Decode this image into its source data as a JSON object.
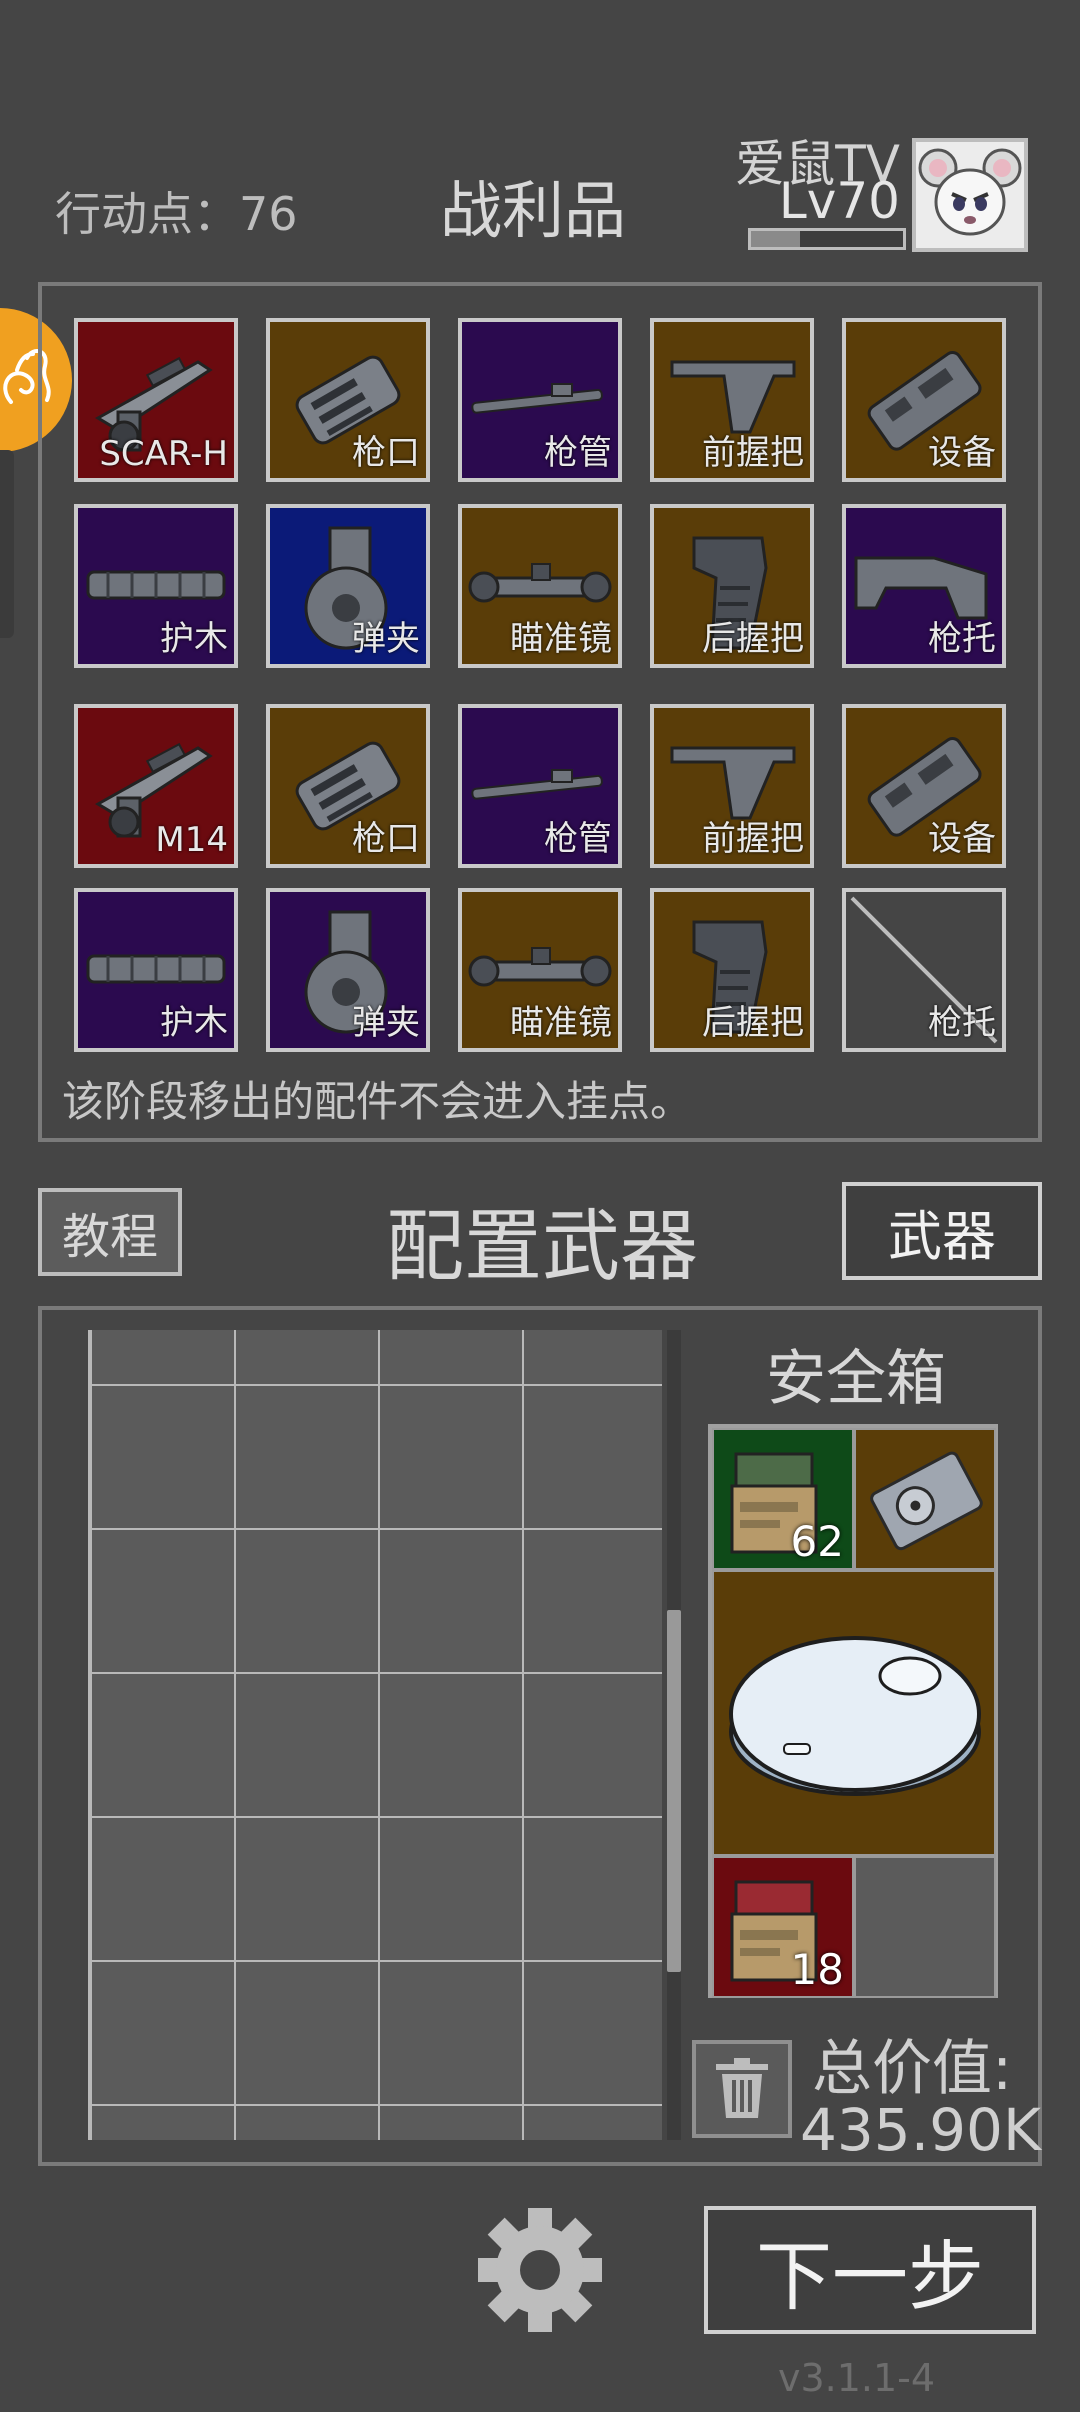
{
  "header": {
    "action_points_label": "行动点：",
    "action_points_value": "76",
    "title": "战利品",
    "username": "爱鼠TV",
    "level": "Lv70",
    "xp_fraction": 0.32
  },
  "loot": {
    "rows": [
      [
        {
          "label": "SCAR-H",
          "rarity": "red",
          "icon": "rifle-icon"
        },
        {
          "label": "枪口",
          "rarity": "orange",
          "icon": "muzzle-icon"
        },
        {
          "label": "枪管",
          "rarity": "purple",
          "icon": "barrel-icon"
        },
        {
          "label": "前握把",
          "rarity": "orange",
          "icon": "foregrip-icon"
        },
        {
          "label": "设备",
          "rarity": "orange",
          "icon": "device-icon"
        }
      ],
      [
        {
          "label": "护木",
          "rarity": "purple",
          "icon": "handguard-icon"
        },
        {
          "label": "弹夹",
          "rarity": "blue",
          "icon": "magazine-icon"
        },
        {
          "label": "瞄准镜",
          "rarity": "orange",
          "icon": "scope-icon"
        },
        {
          "label": "后握把",
          "rarity": "orange",
          "icon": "grip-icon"
        },
        {
          "label": "枪托",
          "rarity": "purple",
          "icon": "stock-icon"
        }
      ],
      [
        {
          "label": "M14",
          "rarity": "red",
          "icon": "rifle-icon"
        },
        {
          "label": "枪口",
          "rarity": "orange",
          "icon": "muzzle-icon"
        },
        {
          "label": "枪管",
          "rarity": "purple",
          "icon": "barrel-icon"
        },
        {
          "label": "前握把",
          "rarity": "orange",
          "icon": "foregrip-icon"
        },
        {
          "label": "设备",
          "rarity": "orange",
          "icon": "device-icon"
        }
      ],
      [
        {
          "label": "护木",
          "rarity": "purple",
          "icon": "handguard-icon"
        },
        {
          "label": "弹夹",
          "rarity": "purple",
          "icon": "magazine-icon"
        },
        {
          "label": "瞄准镜",
          "rarity": "orange",
          "icon": "scope-icon"
        },
        {
          "label": "后握把",
          "rarity": "orange",
          "icon": "grip-icon"
        },
        {
          "label": "枪托",
          "rarity": "empty",
          "icon": "empty-slot-icon"
        }
      ]
    ],
    "note": "该阶段移出的配件不会进入挂点。"
  },
  "config": {
    "tutorial_label": "教程",
    "title": "配置武器",
    "weapon_label": "武器"
  },
  "safe": {
    "title": "安全箱",
    "items": [
      {
        "name": "ammo-box-green",
        "count": "62"
      },
      {
        "name": "hard-drive",
        "count": ""
      },
      {
        "name": "robot-vacuum",
        "count": ""
      },
      {
        "name": "ammo-box-red",
        "count": "18"
      }
    ],
    "total_label": "总价值:",
    "total_value": "435.90K"
  },
  "footer": {
    "next_label": "下一步",
    "version": "v3.1.1-4"
  },
  "colors": {
    "red": "#6b0a0f",
    "orange": "#5a3d08",
    "purple": "#2b0a4f",
    "blue": "#0b1a78",
    "accent": "#f0a020"
  }
}
